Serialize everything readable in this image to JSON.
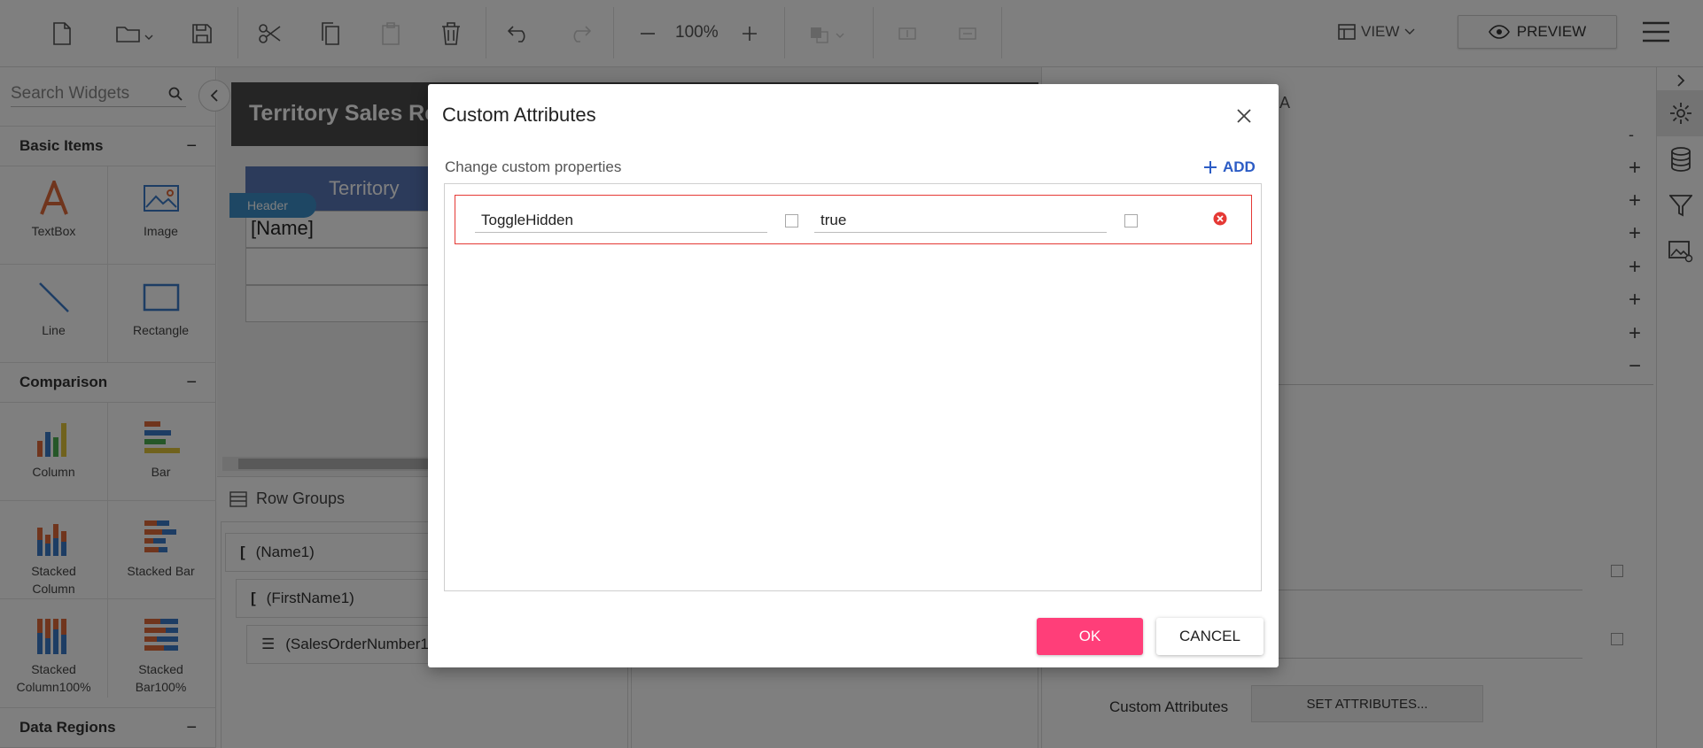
{
  "toolbar": {
    "zoom": "100%",
    "view_label": "VIEW",
    "preview_label": "PREVIEW"
  },
  "widgets": {
    "search_placeholder": "Search Widgets",
    "basic_items": {
      "title": "Basic Items",
      "items": [
        "TextBox",
        "Image",
        "Line",
        "Rectangle"
      ]
    },
    "comparison": {
      "title": "Comparison",
      "items": [
        "Column",
        "Bar",
        "Stacked Column",
        "Stacked Bar",
        "Stacked Column100%",
        "Stacked Bar100%"
      ]
    },
    "data_regions": {
      "title": "Data Regions"
    }
  },
  "canvas": {
    "report_title": "Territory Sales Re",
    "header_tag": "Header",
    "column_header": "Territory",
    "row_name": "[Name]"
  },
  "grouping": {
    "title": "Row Groups",
    "items": [
      "(Name1)",
      "(FirstName1)",
      "(SalesOrderNumber1"
    ]
  },
  "properties": {
    "section_fragment": "A",
    "custom_attributes_label": "Custom Attributes",
    "set_attributes_button": "SET ATTRIBUTES..."
  },
  "dialog": {
    "title": "Custom Attributes",
    "subtitle": "Change custom properties",
    "add_label": "ADD",
    "rows": [
      {
        "name": "ToggleHidden",
        "value": "true"
      }
    ],
    "ok_label": "OK",
    "cancel_label": "CANCEL"
  },
  "colors": {
    "accent_pink": "#ff3e79",
    "link_blue": "#2c5cc5",
    "error_red": "#e53935",
    "table_header_blue": "#5877b7",
    "header_tag_blue": "#3d8fc9"
  }
}
